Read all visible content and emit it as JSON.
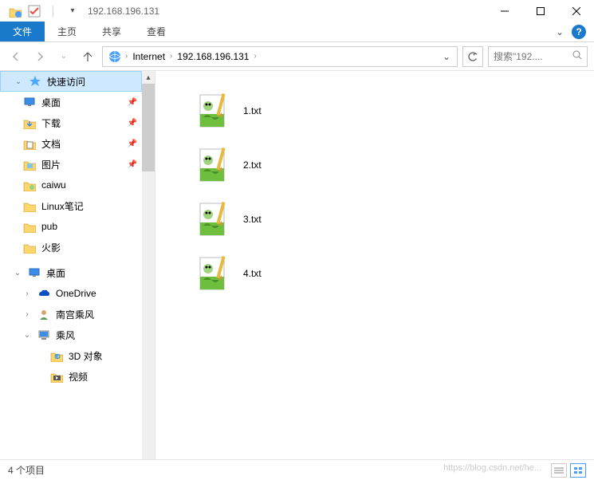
{
  "title": "192.168.196.131",
  "ribbon": {
    "file": "文件",
    "home": "主页",
    "share": "共享",
    "view": "查看"
  },
  "breadcrumb": {
    "items": [
      "Internet",
      "192.168.196.131"
    ]
  },
  "search": {
    "placeholder": "搜索\"192...."
  },
  "quick_access": {
    "label": "快速访问",
    "items": [
      {
        "label": "桌面",
        "pinned": true,
        "icon": "desktop"
      },
      {
        "label": "下载",
        "pinned": true,
        "icon": "downloads"
      },
      {
        "label": "文档",
        "pinned": true,
        "icon": "documents"
      },
      {
        "label": "图片",
        "pinned": true,
        "icon": "pictures"
      },
      {
        "label": "caiwu",
        "pinned": false,
        "icon": "folder-user"
      },
      {
        "label": "Linux笔记",
        "pinned": false,
        "icon": "folder"
      },
      {
        "label": "pub",
        "pinned": false,
        "icon": "folder"
      },
      {
        "label": "火影",
        "pinned": false,
        "icon": "folder"
      }
    ]
  },
  "desktop_section": {
    "label": "桌面",
    "items": [
      {
        "label": "OneDrive",
        "icon": "onedrive"
      },
      {
        "label": "南宫乘风",
        "icon": "user"
      },
      {
        "label": "乘风",
        "icon": "this-pc"
      }
    ],
    "pc_children": [
      {
        "label": "3D 对象",
        "icon": "3d"
      },
      {
        "label": "视频",
        "icon": "videos"
      }
    ]
  },
  "files": [
    {
      "name": "1.txt"
    },
    {
      "name": "2.txt"
    },
    {
      "name": "3.txt"
    },
    {
      "name": "4.txt"
    }
  ],
  "status": {
    "count_text": "4 个项目",
    "watermark": "https://blog.csdn.net/he..."
  }
}
